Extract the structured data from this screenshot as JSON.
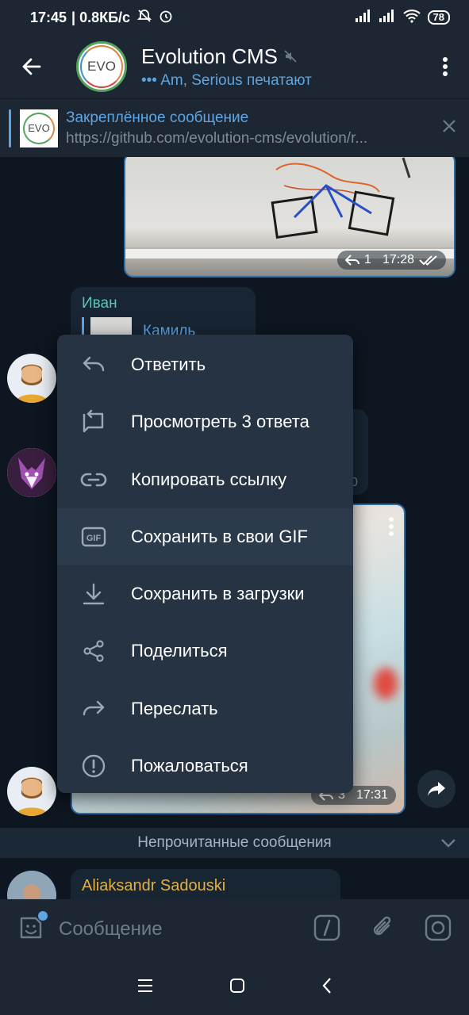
{
  "status_bar": {
    "time": "17:45",
    "net_speed": "| 0.8КБ/с",
    "battery": "78"
  },
  "header": {
    "title": "Evolution CMS",
    "avatar_text": "EVO",
    "typing": "Am, Serious печатают"
  },
  "pinned": {
    "label": "Закреплённое сообщение",
    "url": "https://github.com/evolution-cms/evolution/r...",
    "thumb_text": "EVO"
  },
  "messages": {
    "photo": {
      "replies": "1",
      "time": "17:28"
    },
    "ivan": {
      "sender": "Иван",
      "reply_to": "Камиль"
    },
    "hidden_time": "0",
    "gif": {
      "replies": "3",
      "time": "17:31"
    },
    "unread_label": "Непрочитанные сообщения",
    "aliaksandr": {
      "sender": "Aliaksandr Sadouski"
    }
  },
  "context_menu": {
    "items": [
      {
        "label": "Ответить",
        "icon": "reply-icon"
      },
      {
        "label": "Просмотреть 3 ответа",
        "icon": "view-replies-icon"
      },
      {
        "label": "Копировать ссылку",
        "icon": "link-icon"
      },
      {
        "label": "Сохранить в свои GIF",
        "icon": "gif-icon"
      },
      {
        "label": "Сохранить в загрузки",
        "icon": "download-icon"
      },
      {
        "label": "Поделиться",
        "icon": "share-icon"
      },
      {
        "label": "Переслать",
        "icon": "forward-icon"
      },
      {
        "label": "Пожаловаться",
        "icon": "report-icon"
      }
    ],
    "highlighted_index": 3
  },
  "input": {
    "placeholder": "Сообщение"
  },
  "colors": {
    "background": "#0e1621",
    "header": "#1d2733",
    "menu": "#253342",
    "accent": "#5ea5e4",
    "ivan_name": "#5ec3b5",
    "aliaksandr_name": "#e4b043"
  }
}
